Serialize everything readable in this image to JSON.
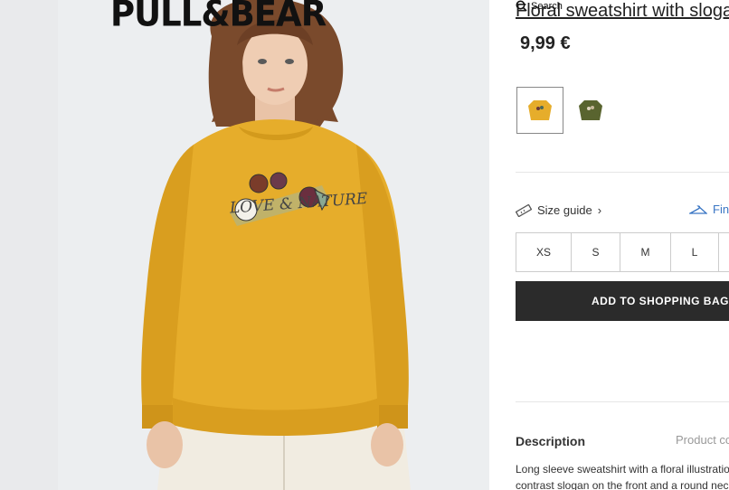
{
  "brand": {
    "logo": "PULL&BEAR"
  },
  "search": {
    "label": "Search"
  },
  "product": {
    "title": "Floral sweatshirt with slogan",
    "price": "9,99 €",
    "print_slogan": "LOVE & NATURE",
    "colors": [
      {
        "name": "mustard",
        "hex": "#e6ad2b",
        "selected": true
      },
      {
        "name": "khaki",
        "hex": "#59642f",
        "selected": false
      }
    ]
  },
  "size_guide": {
    "label": "Size guide",
    "find_label": "Find"
  },
  "sizes": [
    "XS",
    "S",
    "M",
    "L"
  ],
  "cart": {
    "add_label": "ADD TO SHOPPING BAG"
  },
  "description": {
    "title": "Description",
    "tab_label": "Product composition",
    "line1": "Long sleeve sweatshirt with a floral illustration",
    "line2": "contrast slogan on the front and a round neck"
  },
  "colors": {
    "accent_blue": "#3a76c4",
    "button_dark": "#2b2b2b"
  }
}
